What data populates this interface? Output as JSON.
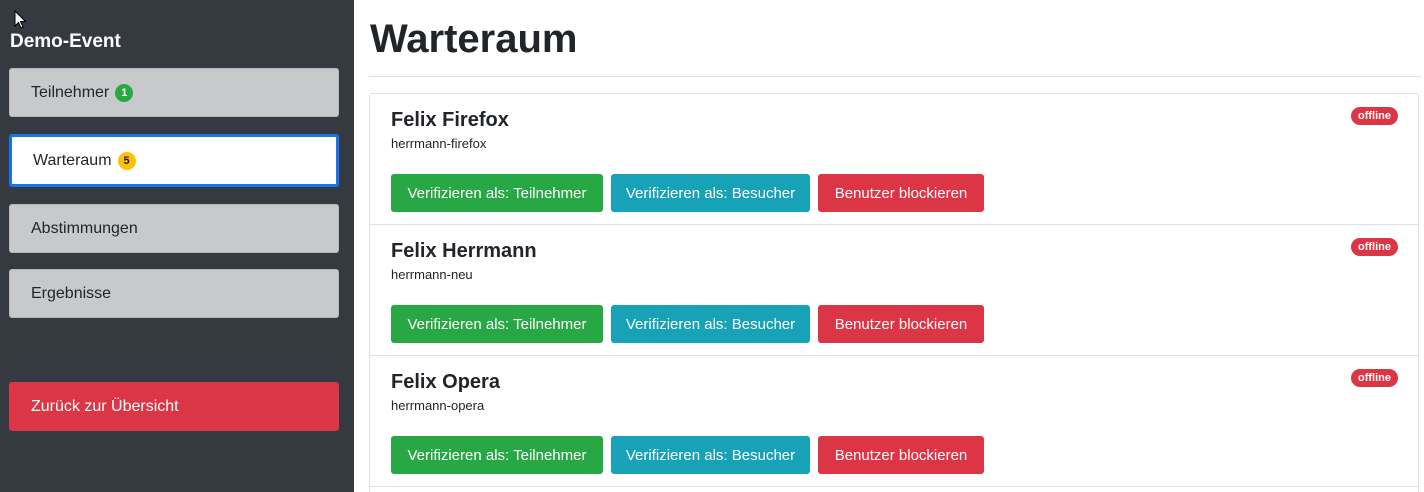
{
  "sidebar": {
    "event_title": "Demo-Event",
    "nav": {
      "teilnehmer": {
        "label": "Teilnehmer",
        "count": "1"
      },
      "warteraum": {
        "label": "Warteraum",
        "count": "5"
      },
      "abstimmungen": {
        "label": "Abstimmungen"
      },
      "ergebnisse": {
        "label": "Ergebnisse"
      }
    },
    "back_label": "Zurück zur Übersicht"
  },
  "main": {
    "title": "Warteraum",
    "users": [
      {
        "name": "Felix Firefox",
        "handle": "herrmann-firefox",
        "status": "offline",
        "verify_participant": "Verifizieren als: Teilnehmer",
        "verify_visitor": "Verifizieren als: Besucher",
        "block": "Benutzer blockieren"
      },
      {
        "name": "Felix Herrmann",
        "handle": "herrmann-neu",
        "status": "offline",
        "verify_participant": "Verifizieren als: Teilnehmer",
        "verify_visitor": "Verifizieren als: Besucher",
        "block": "Benutzer blockieren"
      },
      {
        "name": "Felix Opera",
        "handle": "herrmann-opera",
        "status": "offline",
        "verify_participant": "Verifizieren als: Teilnehmer",
        "verify_visitor": "Verifizieren als: Besucher",
        "block": "Benutzer blockieren"
      }
    ]
  },
  "colors": {
    "sidebar_bg": "#343a40",
    "active_border": "#1a73e8",
    "success": "#28a745",
    "info": "#17a2b8",
    "danger": "#dc3545",
    "warning": "#ffc107"
  }
}
